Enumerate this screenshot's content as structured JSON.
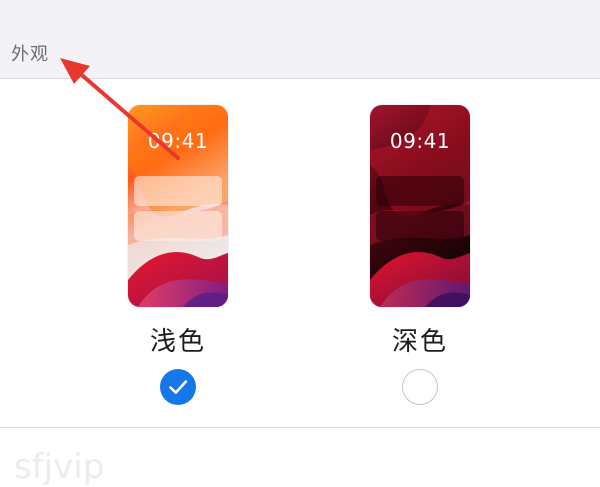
{
  "section": {
    "title": "外观"
  },
  "options": [
    {
      "label": "浅色",
      "time": "09:41",
      "selected": true,
      "icon": "checkmark-icon"
    },
    {
      "label": "深色",
      "time": "09:41",
      "selected": false
    }
  ],
  "watermark": "sfjvip",
  "colors": {
    "accent": "#1577e8",
    "arrow": "#e8372f",
    "header_bg": "#f2f2f7"
  }
}
